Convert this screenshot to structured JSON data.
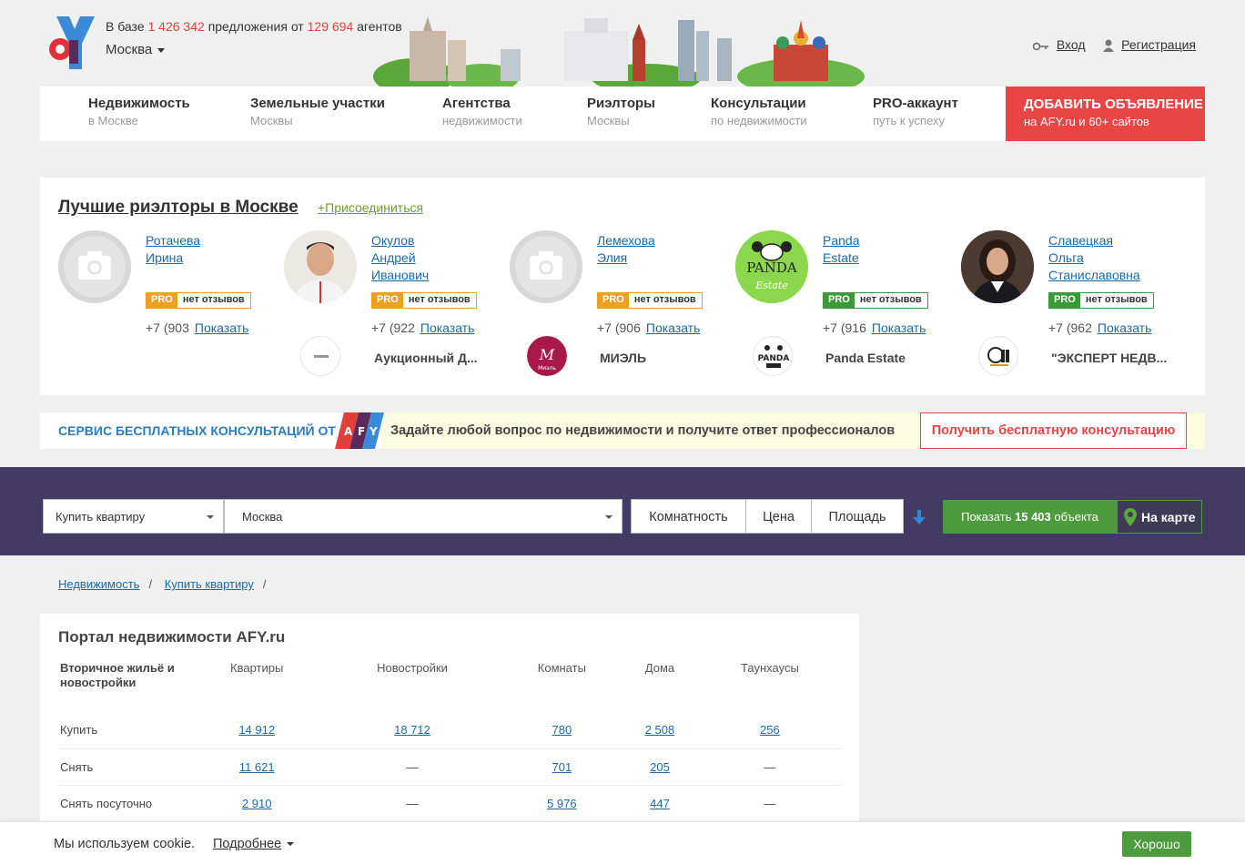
{
  "header": {
    "base_prefix": "В базе",
    "offers_count": "1 426 342",
    "offers_mid": "предложения от",
    "agents_count": "129 694",
    "agents_suffix": "агентов",
    "city": "Москва",
    "login": "Вход",
    "register": "Регистрация"
  },
  "nav": {
    "items": [
      {
        "title": "Недвижимость",
        "subtitle": "в Москве"
      },
      {
        "title": "Земельные участки",
        "subtitle": "Москвы"
      },
      {
        "title": "Агентства",
        "subtitle": "недвижимости"
      },
      {
        "title": "Риэлторы",
        "subtitle": "Москвы"
      },
      {
        "title": "Консультации",
        "subtitle": "по недвижимости"
      },
      {
        "title": "PRO-аккаунт",
        "subtitle": "путь к успеху"
      }
    ],
    "add_title": "ДОБАВИТЬ ОБЪЯВЛЕНИЕ",
    "add_subtitle": "на AFY.ru и 60+ сайтов"
  },
  "realtors": {
    "title": "Лучшие риэлторы в Москве",
    "join": "+Присоединиться",
    "show_label": "Показать",
    "no_reviews": "нет отзывов",
    "pro": "PRO",
    "list": [
      {
        "name1": "Ротачева",
        "name2": "Ирина",
        "name3": "",
        "phone": "+7 (903",
        "agency": "Аукционный Д..."
      },
      {
        "name1": "Окулов",
        "name2": "Андрей",
        "name3": "Иванович",
        "phone": "+7 (922",
        "agency": "МИЭЛЬ"
      },
      {
        "name1": "Лемехова",
        "name2": "Элия",
        "name3": "",
        "phone": "+7 (906",
        "agency": "Panda Estate"
      },
      {
        "name1": "Panda",
        "name2": "Estate",
        "name3": "",
        "phone": "+7 (916",
        "agency": "\"ЭКСПЕРТ НЕДВ..."
      },
      {
        "name1": "Славецкая",
        "name2": "Ольга",
        "name3": "Станиславовна",
        "phone": "+7 (962",
        "agency": ""
      }
    ]
  },
  "consult": {
    "label": "СЕРВИС БЕСПЛАТНЫХ КОНСУЛЬТАЦИЙ ОТ",
    "text": "Задайте любой вопрос по недвижимости и получите ответ профессионалов",
    "button": "Получить бесплатную консультацию"
  },
  "search": {
    "deal": "Купить квартиру",
    "city": "Москва",
    "rooms": "Комнатность",
    "price": "Цена",
    "area": "Площадь",
    "show_prefix": "Показать",
    "show_count": "15 403",
    "show_suffix": "объекта",
    "map": "На карте"
  },
  "breadcrumb": {
    "item1": "Недвижимость",
    "item2": "Купить квартиру"
  },
  "portal": {
    "title": "Портал недвижимости AFY.ru",
    "head_first": "Вторичное жильё и новостройки",
    "columns": [
      "Квартиры",
      "Новостройки",
      "Комнаты",
      "Дома",
      "Таунхаусы"
    ],
    "rows": [
      {
        "label": "Купить",
        "values": [
          "14 912",
          "18 712",
          "780",
          "2 508",
          "256"
        ]
      },
      {
        "label": "Снять",
        "values": [
          "11 621",
          "—",
          "701",
          "205",
          "—"
        ]
      },
      {
        "label": "Снять посуточно",
        "values": [
          "2 910",
          "—",
          "5 976",
          "447",
          "—"
        ]
      }
    ]
  },
  "cookie": {
    "text": "Мы используем cookie.",
    "more": "Подробнее",
    "ok": "Хорошо"
  },
  "colors": {
    "accent_red": "#e84545",
    "search_bg": "#433b63",
    "green": "#4e9a3e",
    "link": "#1a6aa8"
  }
}
